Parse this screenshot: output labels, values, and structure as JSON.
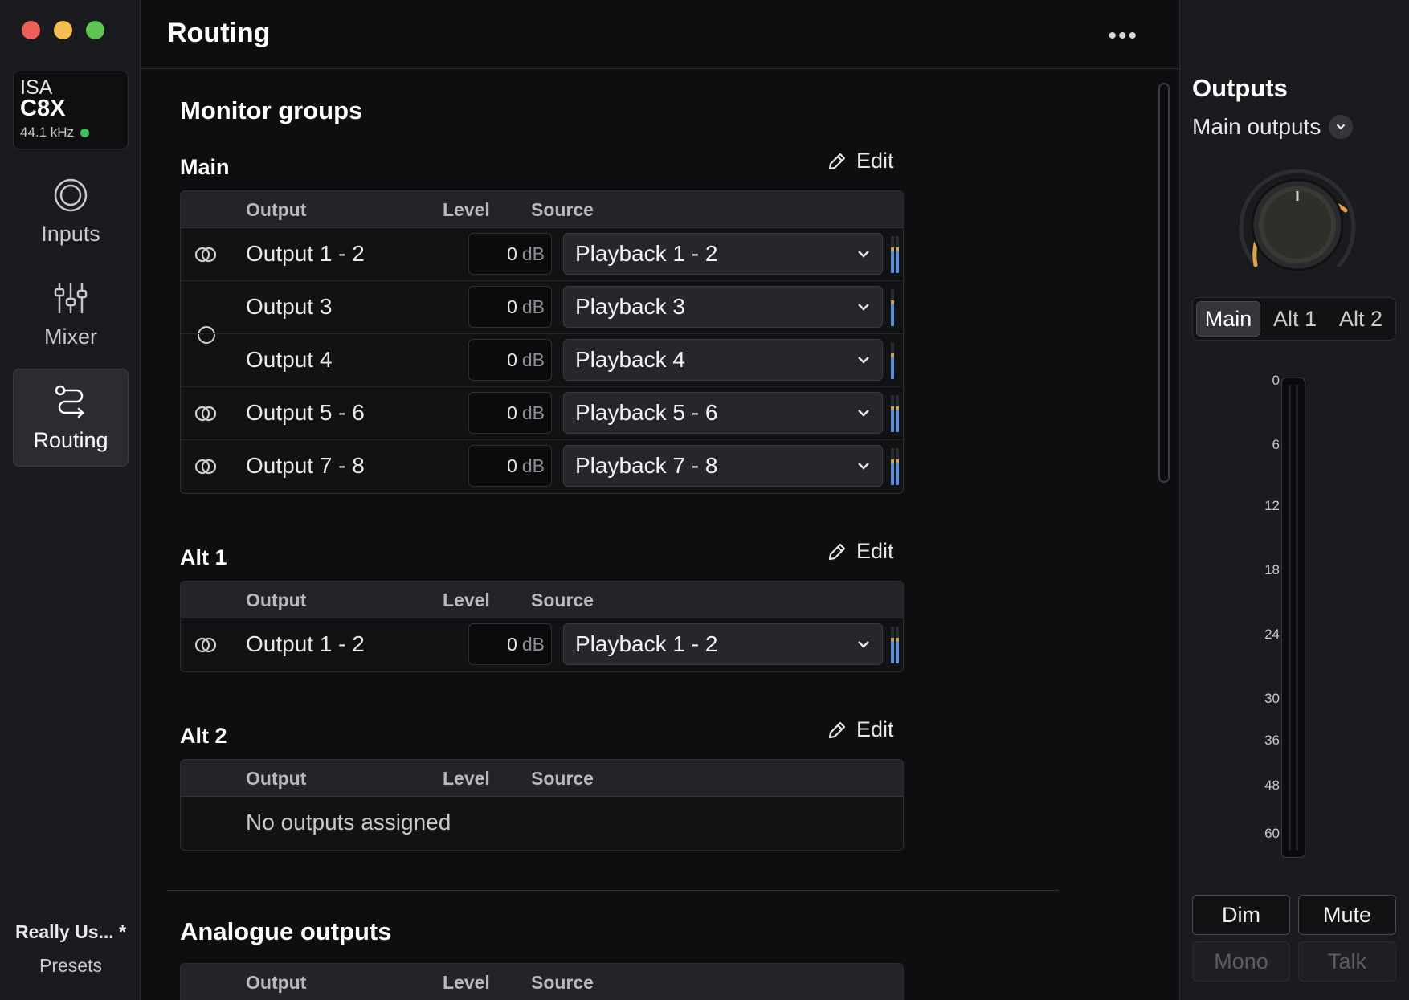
{
  "sidebar": {
    "device": {
      "brand": "ISA",
      "model": "C8X",
      "sample_rate": "44.1 kHz"
    },
    "nav": [
      {
        "label": "Inputs",
        "icon": "inputs-icon"
      },
      {
        "label": "Mixer",
        "icon": "mixer-icon"
      },
      {
        "label": "Routing",
        "icon": "routing-icon"
      }
    ],
    "active_nav": "Routing",
    "preset_name": "Really Us...  *",
    "presets_label": "Presets"
  },
  "header": {
    "title": "Routing",
    "more": "•••"
  },
  "monitor_groups": {
    "title": "Monitor groups",
    "edit_label": "Edit",
    "columns": {
      "output": "Output",
      "level": "Level",
      "source": "Source"
    },
    "main": {
      "title": "Main",
      "rows": [
        {
          "output": "Output 1 - 2",
          "level": "0",
          "unit": "dB",
          "source": "Playback 1 - 2",
          "linked": true
        },
        {
          "output": "Output 3",
          "level": "0",
          "unit": "dB",
          "source": "Playback 3",
          "linked": false
        },
        {
          "output": "Output 4",
          "level": "0",
          "unit": "dB",
          "source": "Playback 4",
          "linked": false
        },
        {
          "output": "Output 5 - 6",
          "level": "0",
          "unit": "dB",
          "source": "Playback 5 - 6",
          "linked": true
        },
        {
          "output": "Output 7 - 8",
          "level": "0",
          "unit": "dB",
          "source": "Playback 7 - 8",
          "linked": true
        }
      ]
    },
    "alt1": {
      "title": "Alt 1",
      "rows": [
        {
          "output": "Output 1 - 2",
          "level": "0",
          "unit": "dB",
          "source": "Playback 1 - 2",
          "linked": true
        }
      ]
    },
    "alt2": {
      "title": "Alt 2",
      "empty": "No outputs assigned"
    }
  },
  "analogue": {
    "title": "Analogue outputs",
    "columns": {
      "output": "Output",
      "level": "Level",
      "source": "Source"
    }
  },
  "outputs_panel": {
    "title": "Outputs",
    "selected": "Main outputs",
    "groups": [
      "Main",
      "Alt 1",
      "Alt 2"
    ],
    "active_group": "Main",
    "scale": [
      "0",
      "6",
      "12",
      "18",
      "24",
      "30",
      "36",
      "48",
      "60"
    ],
    "buttons": {
      "dim": "Dim",
      "mute": "Mute",
      "mono": "Mono",
      "talk": "Talk"
    }
  },
  "colors": {
    "accent_knob": "#e0a447",
    "meter_blue": "#5b8fd9",
    "status_green": "#3fbf5a"
  }
}
